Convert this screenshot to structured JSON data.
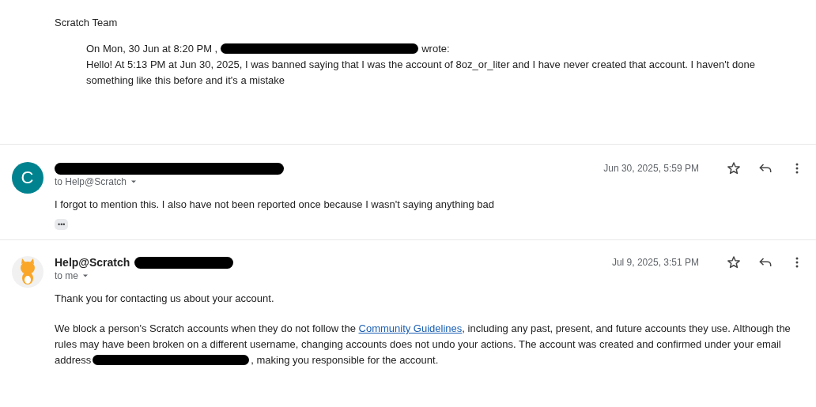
{
  "quoted_message": {
    "signature": "Scratch Team",
    "quote_header_start": "On Mon, 30 Jun at 8:20 PM ,",
    "quote_header_end": "wrote:",
    "quote_body": "Hello! At 5:13 PM at Jun 30, 2025, I was banned saying that I was the account of 8oz_or_liter and I have never created that account. I haven't done something like this before and it's a mistake"
  },
  "messages": [
    {
      "avatar": {
        "kind": "letter",
        "letter": "C"
      },
      "recipient": "to Help@Scratch",
      "date": "Jun 30, 2025, 5:59 PM",
      "paragraphs": [
        [
          {
            "kind": "text",
            "text": "I forgot to mention this. I also have not been reported once because I wasn't saying anything bad"
          }
        ]
      ],
      "trimmed_content": "•••"
    },
    {
      "avatar": {
        "kind": "picture"
      },
      "sender_name": "Help@Scratch",
      "recipient": "to me",
      "date": "Jul 9, 2025, 3:51 PM",
      "paragraphs": [
        [
          {
            "kind": "text",
            "text": "Thank you for contacting us about your account."
          }
        ],
        [
          {
            "kind": "text",
            "text": "We block a person's Scratch accounts when they do not follow the "
          },
          {
            "kind": "link",
            "text": "Community Guidelines"
          },
          {
            "kind": "text",
            "text": ", including any past, present, and future accounts they use. Although the rules may have been broken on a different username, changing accounts does not undo your actions. The account was created and confirmed under your email address"
          },
          {
            "kind": "redaction"
          },
          {
            "kind": "text",
            "text": ", making you responsible for the account."
          }
        ]
      ]
    }
  ]
}
